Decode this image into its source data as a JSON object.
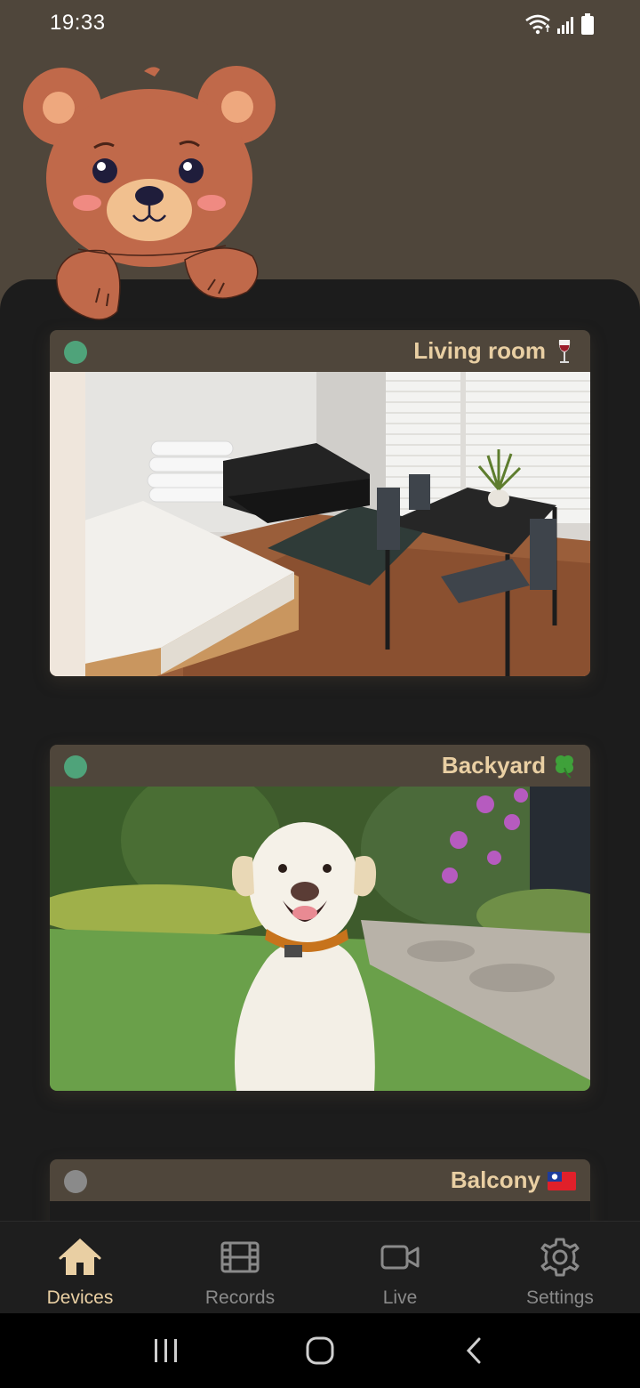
{
  "status_bar": {
    "time": "19:33",
    "icons": [
      "wifi-icon",
      "signal-icon",
      "battery-icon"
    ]
  },
  "colors": {
    "brand_brown": "#4f463b",
    "accent_beige": "#e9cfa3",
    "online_green": "#4fa37a",
    "offline_gray": "#8a8a8a",
    "panel_bg": "#1c1c1c"
  },
  "cameras": [
    {
      "name": "Living room",
      "emoji": "wine-glass-icon",
      "status": "online"
    },
    {
      "name": "Backyard",
      "emoji": "four-leaf-clover-icon",
      "status": "online"
    },
    {
      "name": "Balcony",
      "emoji": "taiwan-flag-icon",
      "status": "offline"
    }
  ],
  "bottom_nav": {
    "items": [
      {
        "label": "Devices",
        "icon": "home-icon",
        "active": true
      },
      {
        "label": "Records",
        "icon": "film-icon",
        "active": false
      },
      {
        "label": "Live",
        "icon": "video-camera-icon",
        "active": false
      },
      {
        "label": "Settings",
        "icon": "gear-icon",
        "active": false
      }
    ]
  },
  "system_nav": [
    "recent-apps-icon",
    "home-circle-icon",
    "back-icon"
  ]
}
